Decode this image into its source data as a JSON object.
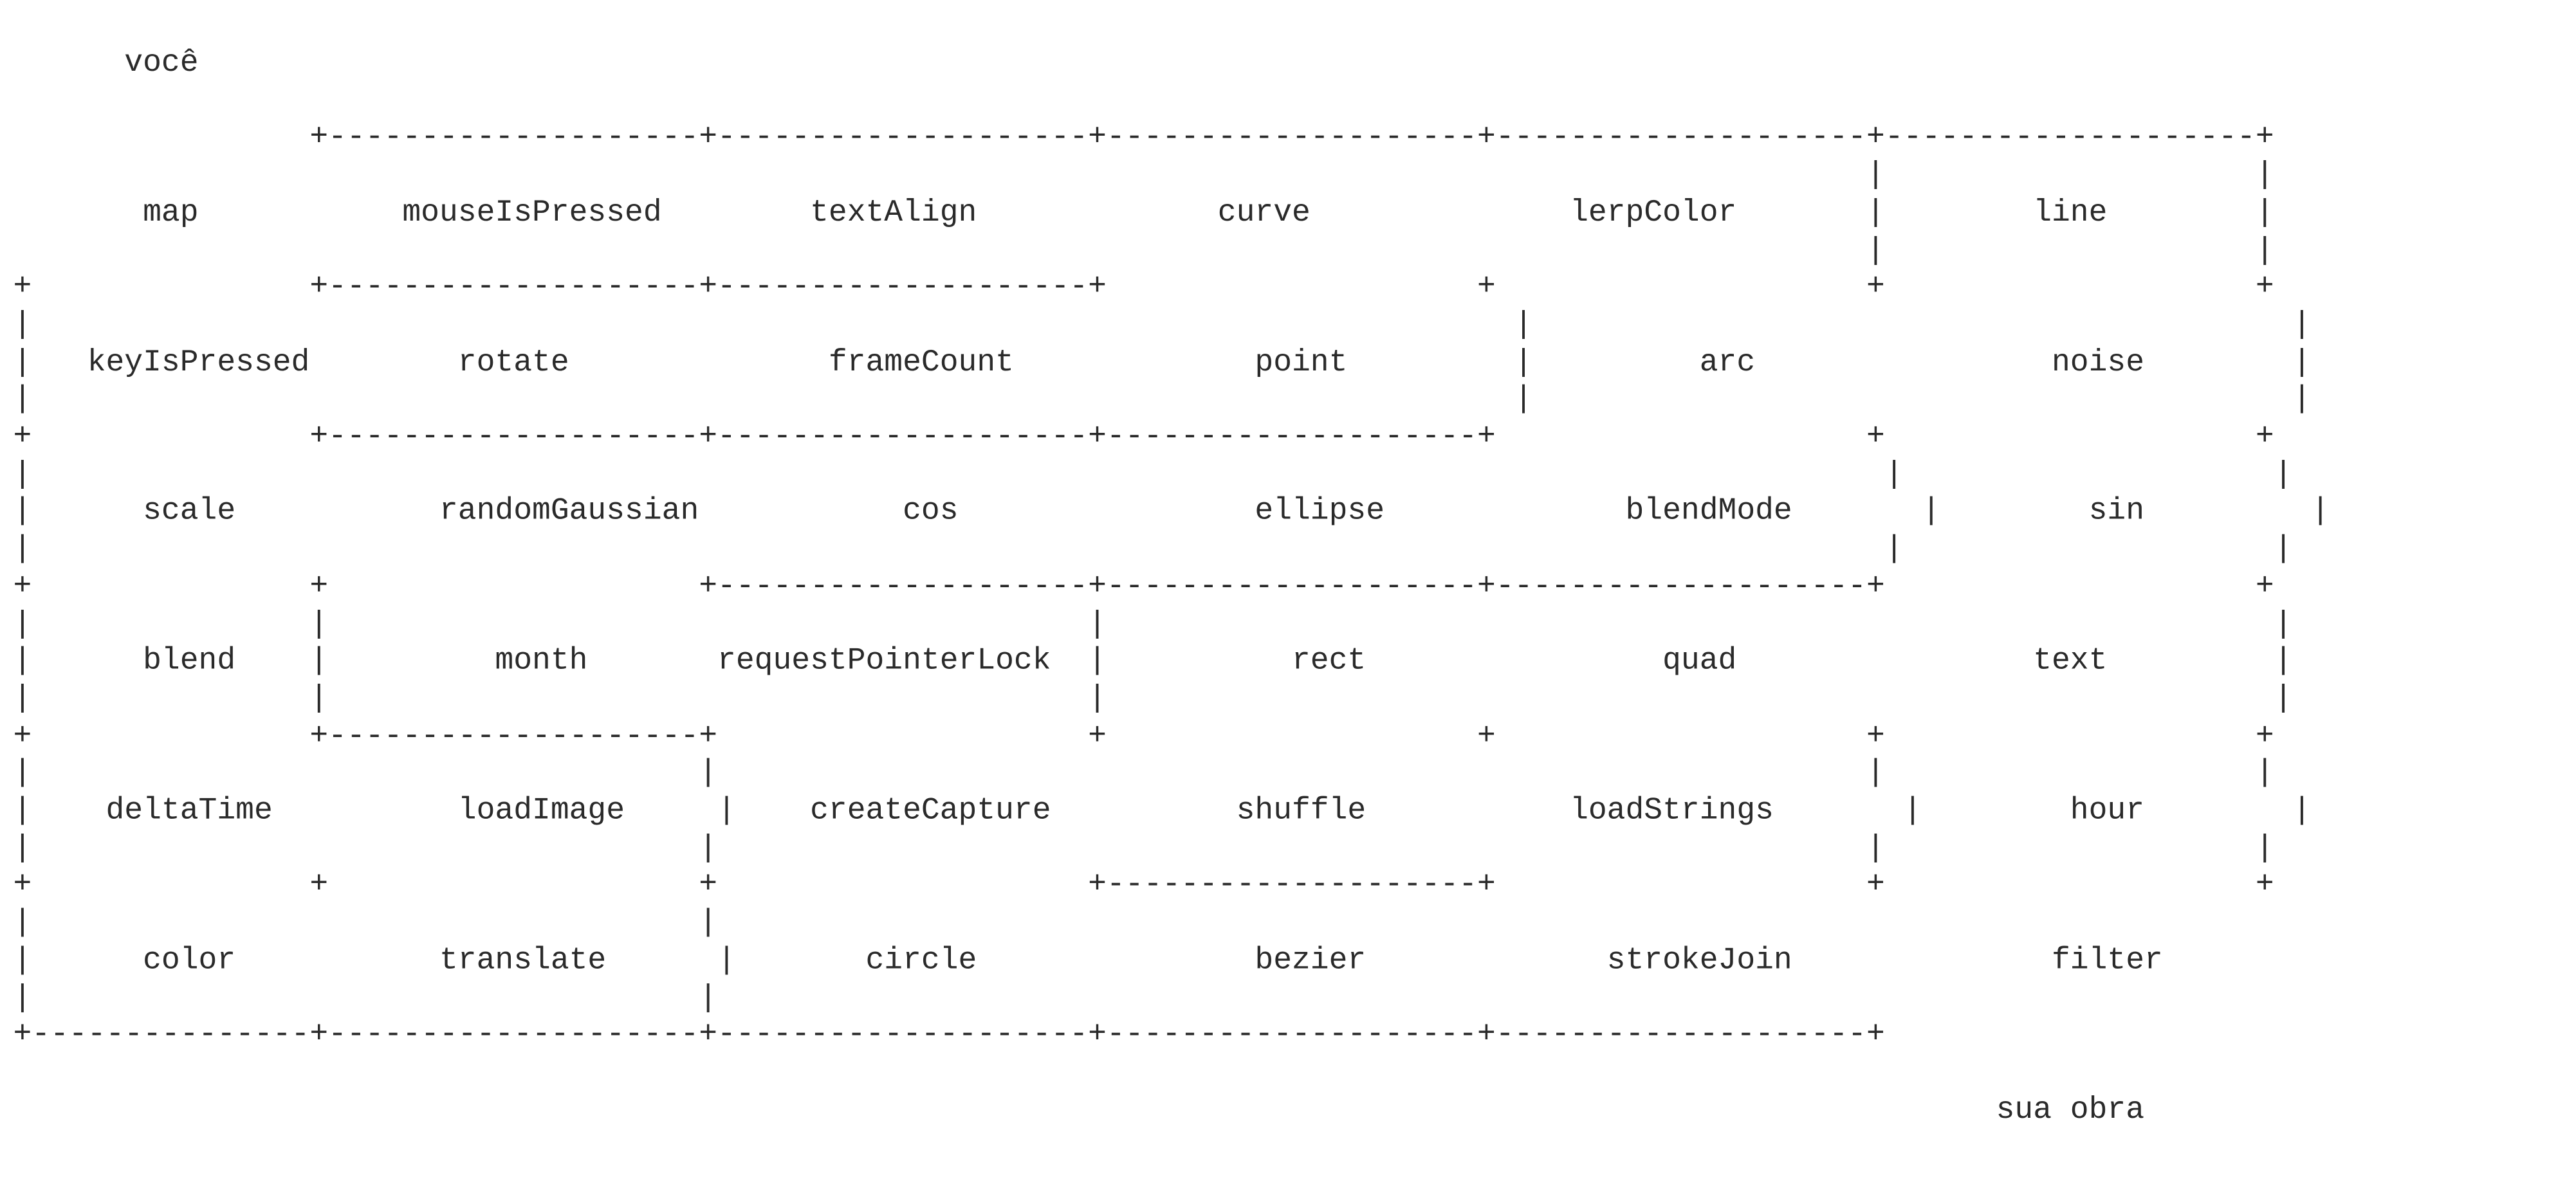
{
  "maze": {
    "lines": [
      "      você",
      "",
      "                +--------------------+--------------------+--------------------+--------------------+--------------------+",
      "                                                                                                    |                    |",
      "       map           mouseIsPressed        textAlign             curve              lerpColor       |        line        |",
      "                                                                                                    |                    |",
      "+               +--------------------+--------------------+                    +                    +                    +",
      "|                                                                                |                                         |",
      "|   keyIsPressed        rotate              frameCount             point         |         arc                noise        |",
      "|                                                                                |                                         |",
      "+               +--------------------+--------------------+--------------------+                    +                    +",
      "|                                                                                                    |                    |",
      "|      scale           randomGaussian           cos                ellipse             blendMode       |        sin         |",
      "|                                                                                                    |                    |",
      "+               +                    +--------------------+--------------------+--------------------+                    +",
      "|               |                                         |                                                               |",
      "|      blend    |         month       requestPointerLock  |          rect                quad                text         |",
      "|               |                                         |                                                               |",
      "+               +--------------------+                    +                    +                    +                    +",
      "|                                    |                                                              |                    |",
      "|    deltaTime          loadImage     |    createCapture          shuffle           loadStrings       |        hour        |",
      "|                                    |                                                              |                    |",
      "+               +                    +                    +--------------------+                    +                    +",
      "|                                    |                                                                                    ",
      "|      color           translate      |       circle               bezier             strokeJoin              filter       ",
      "|                                    |                                                                                    ",
      "+---------------+--------------------+--------------------+--------------------+--------------------+",
      "",
      "                                                                                                           sua obra"
    ]
  }
}
